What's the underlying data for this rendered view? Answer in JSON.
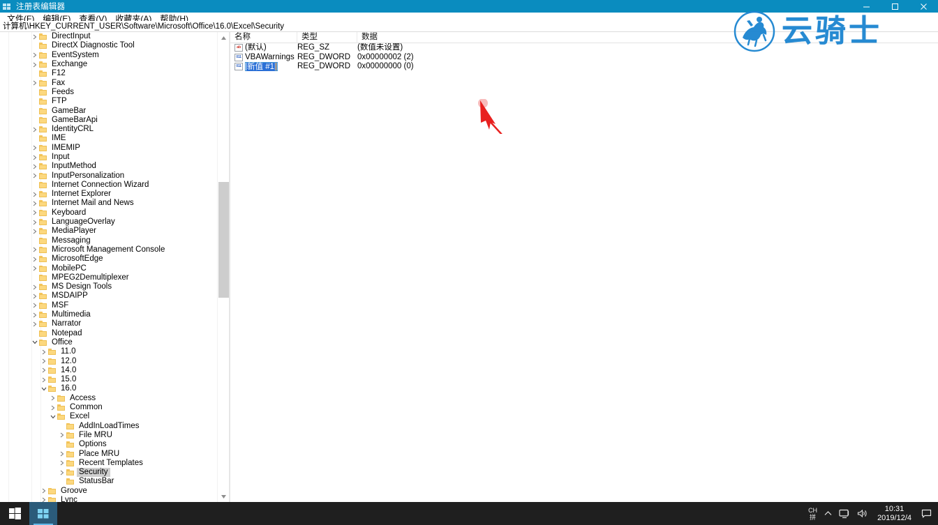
{
  "window": {
    "title": "注册表编辑器",
    "icon": "registry-editor-icon",
    "controls": {
      "minimize": "最小化",
      "maximize": "最大化",
      "close": "关闭"
    }
  },
  "menubar": {
    "items": [
      {
        "label": "文件(F)",
        "name": "menu-file"
      },
      {
        "label": "编辑(E)",
        "name": "menu-edit"
      },
      {
        "label": "查看(V)",
        "name": "menu-view"
      },
      {
        "label": "收藏夹(A)",
        "name": "menu-favorites"
      },
      {
        "label": "帮助(H)",
        "name": "menu-help"
      }
    ]
  },
  "address": {
    "path": "计算机\\HKEY_CURRENT_USER\\Software\\Microsoft\\Office\\16.0\\Excel\\Security"
  },
  "tree": {
    "nodes": [
      {
        "label": "DirectInput",
        "indent": 1,
        "state": "collapsed"
      },
      {
        "label": "DirectX Diagnostic Tool",
        "indent": 1,
        "state": "leaf"
      },
      {
        "label": "EventSystem",
        "indent": 1,
        "state": "collapsed"
      },
      {
        "label": "Exchange",
        "indent": 1,
        "state": "collapsed"
      },
      {
        "label": "F12",
        "indent": 1,
        "state": "leaf"
      },
      {
        "label": "Fax",
        "indent": 1,
        "state": "collapsed"
      },
      {
        "label": "Feeds",
        "indent": 1,
        "state": "leaf"
      },
      {
        "label": "FTP",
        "indent": 1,
        "state": "leaf"
      },
      {
        "label": "GameBar",
        "indent": 1,
        "state": "leaf"
      },
      {
        "label": "GameBarApi",
        "indent": 1,
        "state": "leaf"
      },
      {
        "label": "IdentityCRL",
        "indent": 1,
        "state": "collapsed"
      },
      {
        "label": "IME",
        "indent": 1,
        "state": "leaf"
      },
      {
        "label": "IMEMIP",
        "indent": 1,
        "state": "collapsed"
      },
      {
        "label": "Input",
        "indent": 1,
        "state": "collapsed"
      },
      {
        "label": "InputMethod",
        "indent": 1,
        "state": "collapsed"
      },
      {
        "label": "InputPersonalization",
        "indent": 1,
        "state": "collapsed"
      },
      {
        "label": "Internet Connection Wizard",
        "indent": 1,
        "state": "leaf"
      },
      {
        "label": "Internet Explorer",
        "indent": 1,
        "state": "collapsed"
      },
      {
        "label": "Internet Mail and News",
        "indent": 1,
        "state": "collapsed"
      },
      {
        "label": "Keyboard",
        "indent": 1,
        "state": "collapsed"
      },
      {
        "label": "LanguageOverlay",
        "indent": 1,
        "state": "collapsed"
      },
      {
        "label": "MediaPlayer",
        "indent": 1,
        "state": "collapsed"
      },
      {
        "label": "Messaging",
        "indent": 1,
        "state": "leaf"
      },
      {
        "label": "Microsoft Management Console",
        "indent": 1,
        "state": "collapsed"
      },
      {
        "label": "MicrosoftEdge",
        "indent": 1,
        "state": "collapsed"
      },
      {
        "label": "MobilePC",
        "indent": 1,
        "state": "collapsed"
      },
      {
        "label": "MPEG2Demultiplexer",
        "indent": 1,
        "state": "leaf"
      },
      {
        "label": "MS Design Tools",
        "indent": 1,
        "state": "collapsed"
      },
      {
        "label": "MSDAIPP",
        "indent": 1,
        "state": "collapsed"
      },
      {
        "label": "MSF",
        "indent": 1,
        "state": "collapsed"
      },
      {
        "label": "Multimedia",
        "indent": 1,
        "state": "collapsed"
      },
      {
        "label": "Narrator",
        "indent": 1,
        "state": "collapsed"
      },
      {
        "label": "Notepad",
        "indent": 1,
        "state": "leaf"
      },
      {
        "label": "Office",
        "indent": 1,
        "state": "expanded"
      },
      {
        "label": "11.0",
        "indent": 2,
        "state": "collapsed"
      },
      {
        "label": "12.0",
        "indent": 2,
        "state": "collapsed"
      },
      {
        "label": "14.0",
        "indent": 2,
        "state": "collapsed"
      },
      {
        "label": "15.0",
        "indent": 2,
        "state": "collapsed"
      },
      {
        "label": "16.0",
        "indent": 2,
        "state": "expanded"
      },
      {
        "label": "Access",
        "indent": 3,
        "state": "collapsed"
      },
      {
        "label": "Common",
        "indent": 3,
        "state": "collapsed"
      },
      {
        "label": "Excel",
        "indent": 3,
        "state": "expanded"
      },
      {
        "label": "AddInLoadTimes",
        "indent": 4,
        "state": "leaf"
      },
      {
        "label": "File MRU",
        "indent": 4,
        "state": "collapsed"
      },
      {
        "label": "Options",
        "indent": 4,
        "state": "leaf"
      },
      {
        "label": "Place MRU",
        "indent": 4,
        "state": "collapsed"
      },
      {
        "label": "Recent Templates",
        "indent": 4,
        "state": "collapsed"
      },
      {
        "label": "Security",
        "indent": 4,
        "state": "collapsed",
        "selected": true
      },
      {
        "label": "StatusBar",
        "indent": 4,
        "state": "leaf"
      },
      {
        "label": "Groove",
        "indent": 2,
        "state": "collapsed"
      },
      {
        "label": "Lync",
        "indent": 2,
        "state": "collapsed"
      }
    ]
  },
  "values": {
    "columns": [
      "名称",
      "类型",
      "数据"
    ],
    "rows": [
      {
        "icon": "reg-sz-icon",
        "icon_glyph": "ab",
        "name": "(默认)",
        "type": "REG_SZ",
        "data": "(数值未设置)",
        "editing": false
      },
      {
        "icon": "reg-dword-icon",
        "icon_glyph": "011",
        "name": "VBAWarnings",
        "type": "REG_DWORD",
        "data": "0x00000002 (2)",
        "editing": false
      },
      {
        "icon": "reg-dword-icon",
        "icon_glyph": "011",
        "name": "新值 #1",
        "type": "REG_DWORD",
        "data": "0x00000000 (0)",
        "editing": true
      }
    ]
  },
  "watermark": {
    "text": "云骑士",
    "color": "#1b84d0"
  },
  "annotation": {
    "type": "red-arrow",
    "color": "#e8201f"
  },
  "taskbar": {
    "start": "开始",
    "apps": [
      {
        "name": "taskbar-regedit",
        "label": "注册表编辑器",
        "active": true
      }
    ],
    "tray": {
      "ime_top": "CH",
      "ime_bottom": "拼",
      "overflow": "显示隐藏的图标",
      "network": "网络",
      "volume": "音量",
      "notifications": "通知"
    },
    "clock": {
      "time": "10:31",
      "date": "2019/12/4"
    }
  },
  "colors": {
    "titlebar": "#0a8cbf",
    "selection": "#2a6fd6",
    "tree_selected": "#cfcfcf",
    "taskbar": "#1f1f1f",
    "folder": "#fcd87f"
  }
}
